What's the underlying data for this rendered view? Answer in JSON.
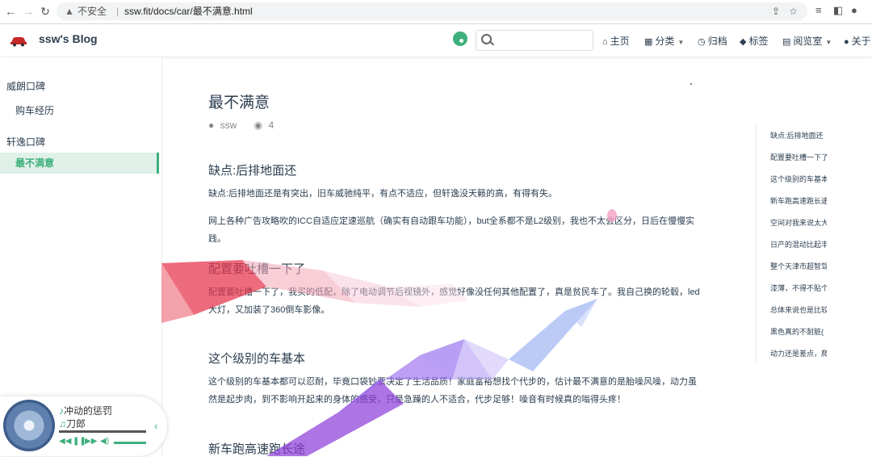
{
  "browser": {
    "insecure_label": "不安全",
    "separator": "|",
    "url": "ssw.fit/docs/car/最不满意.html"
  },
  "navbar": {
    "site_name": "ssw's Blog",
    "search_placeholder": "",
    "items": [
      {
        "icon": "home-icon",
        "label": "主页"
      },
      {
        "icon": "grid-icon",
        "label": "分类"
      },
      {
        "icon": "clock-icon",
        "label": "归档"
      },
      {
        "icon": "tag-icon",
        "label": "标签"
      },
      {
        "icon": "book-icon",
        "label": "阅览室"
      },
      {
        "icon": "user-icon",
        "label": "关于"
      }
    ],
    "accent_color": "#3eaf7c"
  },
  "sidebar": {
    "groups": [
      {
        "label": "威朗口碑",
        "items": [
          {
            "label": "购车经历",
            "active": false
          }
        ]
      },
      {
        "label": "轩逸口碑",
        "items": [
          {
            "label": "最不满意",
            "active": true
          }
        ]
      }
    ]
  },
  "article": {
    "title": "最不满意",
    "author": "ssw",
    "views": "4",
    "sections": [
      {
        "heading": "缺点:后排地面还",
        "paragraphs": [
          "缺点:后排地面还是有突出，旧车威驰纯平，有点不适应，但轩逸没天籁的高，有得有失。",
          "网上各种广告攻略吹的ICC自适应定速巡航（确实有自动跟车功能），but全系都不是L2级别，我也不太会区分，日后在慢慢实践。"
        ]
      },
      {
        "heading": "配置要吐槽一下了",
        "paragraphs": [
          "配置要吐槽一下了，我买的低配，除了电动调节后视镜外，感觉好像没任何其他配置了，真是贫民车了。我自己换的轮毂，led大灯，又加装了360倒车影像。"
        ]
      },
      {
        "heading": "这个级别的车基本",
        "paragraphs": [
          "这个级别的车基本都可以忍耐，毕竟口袋钞票决定了生活品质！家庭富裕想找个代步的，估计最不满意的是胎噪风噪，动力虽然是起步肉，到不影响开起来的身体的感受，只是急躁的人不适合，代步足够！噪音有时候真的嗡得头疼！"
        ]
      },
      {
        "heading": "新车跑高速跑长途",
        "paragraphs": []
      }
    ]
  },
  "toc": [
    "缺点:后排地面还",
    "配置要吐槽一下了",
    "这个级别的车基本",
    "新车跑高速跑长途",
    "空间对我来说太大",
    "日产的混动比起丰",
    "整个天津市超智驾",
    "漆薄，不得不贴个",
    "总体来说也是比较",
    "黑色真的不耐脏(",
    "动力还是差点，爬"
  ],
  "player": {
    "song": "冲动的惩罚",
    "artist": "刀郎"
  }
}
